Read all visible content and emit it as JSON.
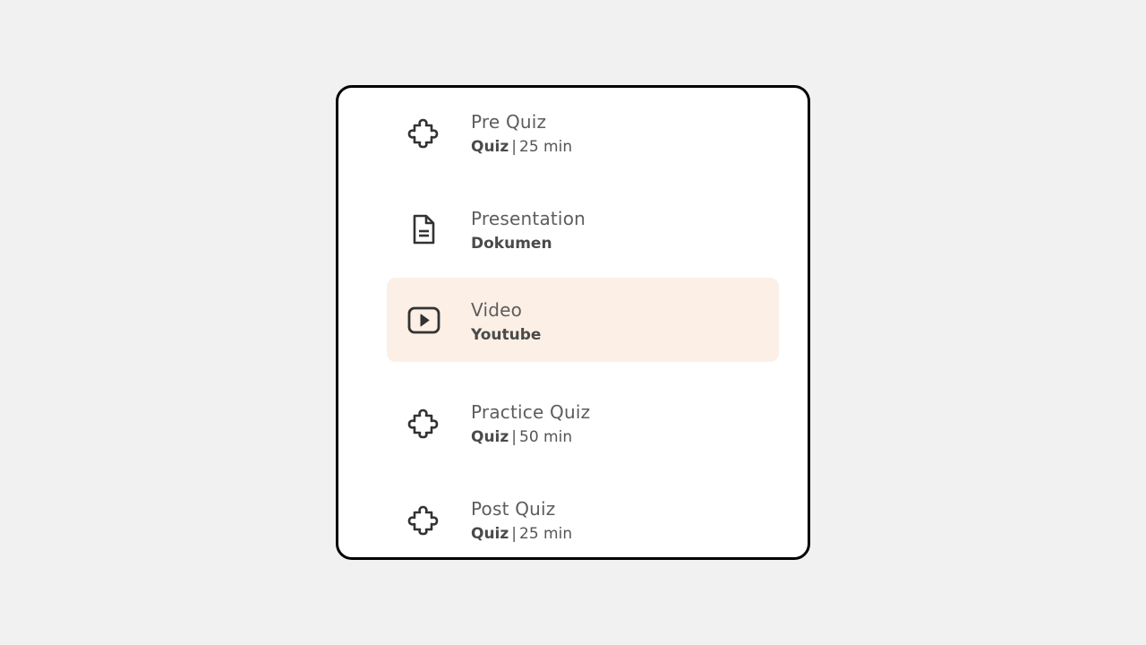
{
  "items": [
    {
      "title": "Pre Quiz",
      "kind": "Quiz",
      "separator": "|",
      "duration": "25 min",
      "icon": "puzzle-icon",
      "active": false
    },
    {
      "title": "Presentation",
      "kind": "Dokumen",
      "separator": "",
      "duration": "",
      "icon": "document-icon",
      "active": false
    },
    {
      "title": "Video",
      "kind": "Youtube",
      "separator": "",
      "duration": "",
      "icon": "play-icon",
      "active": true
    },
    {
      "title": "Practice Quiz",
      "kind": "Quiz",
      "separator": "|",
      "duration": "50 min",
      "icon": "puzzle-icon",
      "active": false
    },
    {
      "title": "Post Quiz",
      "kind": "Quiz",
      "separator": "|",
      "duration": "25 min",
      "icon": "puzzle-icon",
      "active": false
    }
  ],
  "colors": {
    "active_bg": "#fcefe5",
    "icon": "#333333",
    "title": "#5d5d5d",
    "border": "#000000"
  }
}
